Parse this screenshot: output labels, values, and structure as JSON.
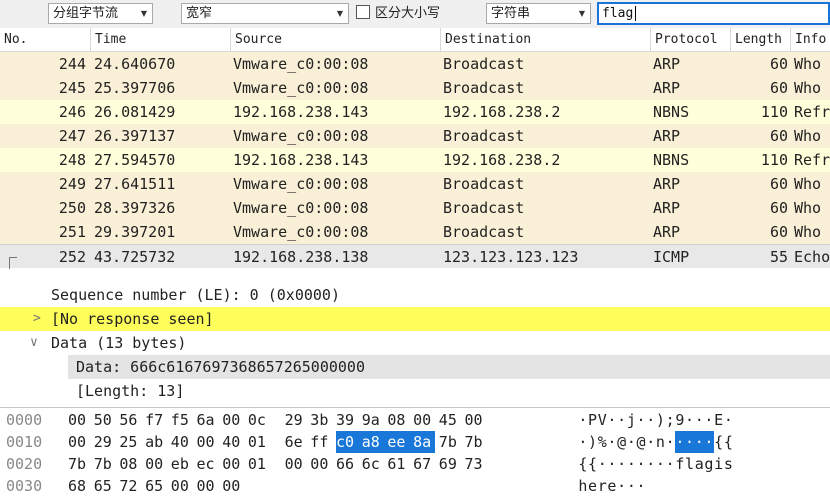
{
  "toolbar": {
    "display_mode": "分组字节流",
    "char_width": "宽窄",
    "case_sensitive_label": "区分大小写",
    "search_type": "字符串",
    "search_value": "flag"
  },
  "packet_list": {
    "columns": [
      "No.",
      "Time",
      "Source",
      "Destination",
      "Protocol",
      "Length",
      "Info"
    ],
    "rows": [
      {
        "no": "244",
        "time": "24.640670",
        "src": "Vmware_c0:00:08",
        "dst": "Broadcast",
        "proto": "ARP",
        "len": "60",
        "info": "Who",
        "color": "tan"
      },
      {
        "no": "245",
        "time": "25.397706",
        "src": "Vmware_c0:00:08",
        "dst": "Broadcast",
        "proto": "ARP",
        "len": "60",
        "info": "Who",
        "color": "tan"
      },
      {
        "no": "246",
        "time": "26.081429",
        "src": "192.168.238.143",
        "dst": "192.168.238.2",
        "proto": "NBNS",
        "len": "110",
        "info": "Refr",
        "color": "yellow"
      },
      {
        "no": "247",
        "time": "26.397137",
        "src": "Vmware_c0:00:08",
        "dst": "Broadcast",
        "proto": "ARP",
        "len": "60",
        "info": "Who",
        "color": "tan"
      },
      {
        "no": "248",
        "time": "27.594570",
        "src": "192.168.238.143",
        "dst": "192.168.238.2",
        "proto": "NBNS",
        "len": "110",
        "info": "Refr",
        "color": "yellow"
      },
      {
        "no": "249",
        "time": "27.641511",
        "src": "Vmware_c0:00:08",
        "dst": "Broadcast",
        "proto": "ARP",
        "len": "60",
        "info": "Who",
        "color": "tan"
      },
      {
        "no": "250",
        "time": "28.397326",
        "src": "Vmware_c0:00:08",
        "dst": "Broadcast",
        "proto": "ARP",
        "len": "60",
        "info": "Who",
        "color": "tan"
      },
      {
        "no": "251",
        "time": "29.397201",
        "src": "Vmware_c0:00:08",
        "dst": "Broadcast",
        "proto": "ARP",
        "len": "60",
        "info": "Who",
        "color": "tan"
      },
      {
        "no": "252",
        "time": "43.725732",
        "src": "192.168.238.138",
        "dst": "123.123.123.123",
        "proto": "ICMP",
        "len": "55",
        "info": "Echo",
        "color": "selected"
      }
    ]
  },
  "details": {
    "seq": "Sequence number (LE): 0 (0x0000)",
    "no_response": "[No response seen]",
    "data_header": "Data (13 bytes)",
    "data_value": "Data: 666c6167697368657265000000",
    "length": "[Length: 13]"
  },
  "bytes_pane": {
    "rows": [
      {
        "offset": "0000",
        "bytes": [
          "00",
          "50",
          "56",
          "f7",
          "f5",
          "6a",
          "00",
          "0c",
          "29",
          "3b",
          "39",
          "9a",
          "08",
          "00",
          "45",
          "00"
        ],
        "ascii": "·PV··j··);9···E·"
      },
      {
        "offset": "0010",
        "bytes": [
          "00",
          "29",
          "25",
          "ab",
          "40",
          "00",
          "40",
          "01",
          "6e",
          "ff",
          "c0",
          "a8",
          "ee",
          "8a",
          "7b",
          "7b"
        ],
        "ascii": "·)%·@·@·n·····{{"
      },
      {
        "offset": "0020",
        "bytes": [
          "7b",
          "7b",
          "08",
          "00",
          "eb",
          "ec",
          "00",
          "01",
          "00",
          "00",
          "66",
          "6c",
          "61",
          "67",
          "69",
          "73"
        ],
        "ascii": "{{········flagis"
      },
      {
        "offset": "0030",
        "bytes": [
          "68",
          "65",
          "72",
          "65",
          "00",
          "00",
          "00"
        ],
        "ascii": "here···"
      }
    ],
    "highlight": {
      "row": 1,
      "from": 10,
      "to": 13
    }
  }
}
